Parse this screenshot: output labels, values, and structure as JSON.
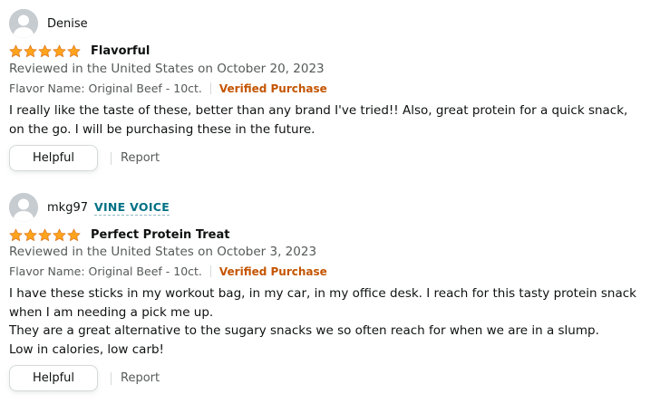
{
  "colors": {
    "star": "#ffa41c",
    "verified": "#c45500",
    "vine": "#007185",
    "secondary_text": "#565959"
  },
  "reviews": [
    {
      "author": "Denise",
      "avatar_icon": "user-silhouette-icon",
      "badge": "",
      "rating": 5,
      "rating_max": 5,
      "title": "Flavorful",
      "date_line": "Reviewed in the United States on October 20, 2023",
      "format": "Flavor Name: Original Beef - 10ct.",
      "verified": "Verified Purchase",
      "body_lines": [
        "I really like the taste of these, better than any brand I've tried!! Also, great protein for a quick snack, on the go. I will be purchasing these in the future."
      ],
      "helpful_label": "Helpful",
      "report_label": "Report"
    },
    {
      "author": "mkg97",
      "avatar_icon": "user-silhouette-icon",
      "badge": "VINE VOICE",
      "rating": 5,
      "rating_max": 5,
      "title": "Perfect Protein Treat",
      "date_line": "Reviewed in the United States on October 3, 2023",
      "format": "Flavor Name: Original Beef - 10ct.",
      "verified": "Verified Purchase",
      "body_lines": [
        "I have these sticks in my workout bag, in my car, in my office desk. I reach for this tasty protein snack when I am needing a pick me up.",
        "They are a great alternative to the sugary snacks we so often reach for when we are in a slump.",
        "Low in calories, low carb!"
      ],
      "helpful_label": "Helpful",
      "report_label": "Report"
    }
  ]
}
